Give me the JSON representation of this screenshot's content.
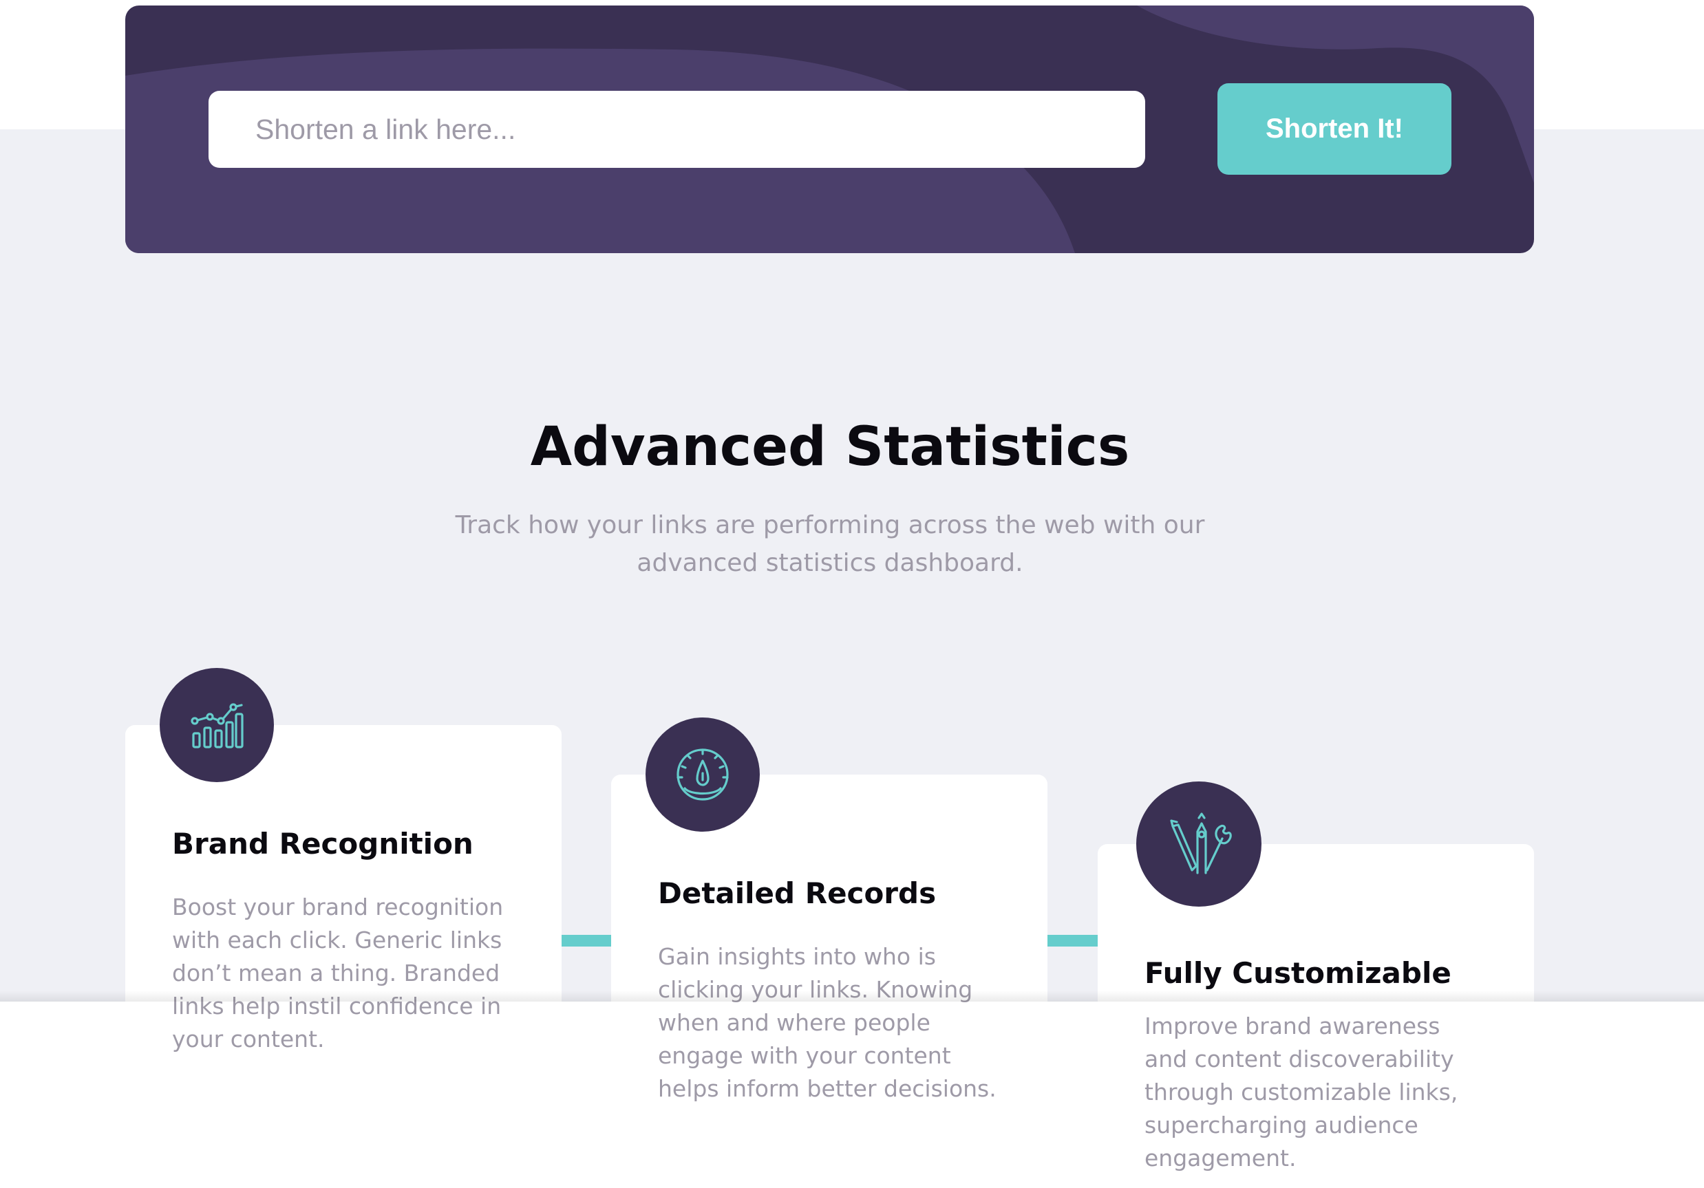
{
  "shorten": {
    "input_placeholder": "Shorten a link here...",
    "input_value": "",
    "button_label": "Shorten It!"
  },
  "statistics": {
    "title": "Advanced Statistics",
    "subtitle": "Track how your links are performing across the web with our advanced statistics dashboard.",
    "cards": [
      {
        "icon": "brand-recognition-icon",
        "title": "Brand Recognition",
        "text": "Boost your brand recognition with each click. Generic links don’t mean a thing. Branded links help instil confidence in your content."
      },
      {
        "icon": "detailed-records-icon",
        "title": "Detailed Records",
        "text": "Gain insights into who is clicking your links. Knowing when and where people engage with your content helps inform better decisions."
      },
      {
        "icon": "fully-customizable-icon",
        "title": "Fully Customizable",
        "text": "Improve brand awareness and content discoverability through customizable links, supercharging audience engagement."
      }
    ]
  },
  "colors": {
    "dark_violet": "#3a3053",
    "violet_light": "#4b3f6b",
    "cyan": "#65cdcc",
    "gray_bg": "#eff0f5",
    "grayish_violet": "#9e9aa7",
    "heading": "#0b0a10"
  }
}
